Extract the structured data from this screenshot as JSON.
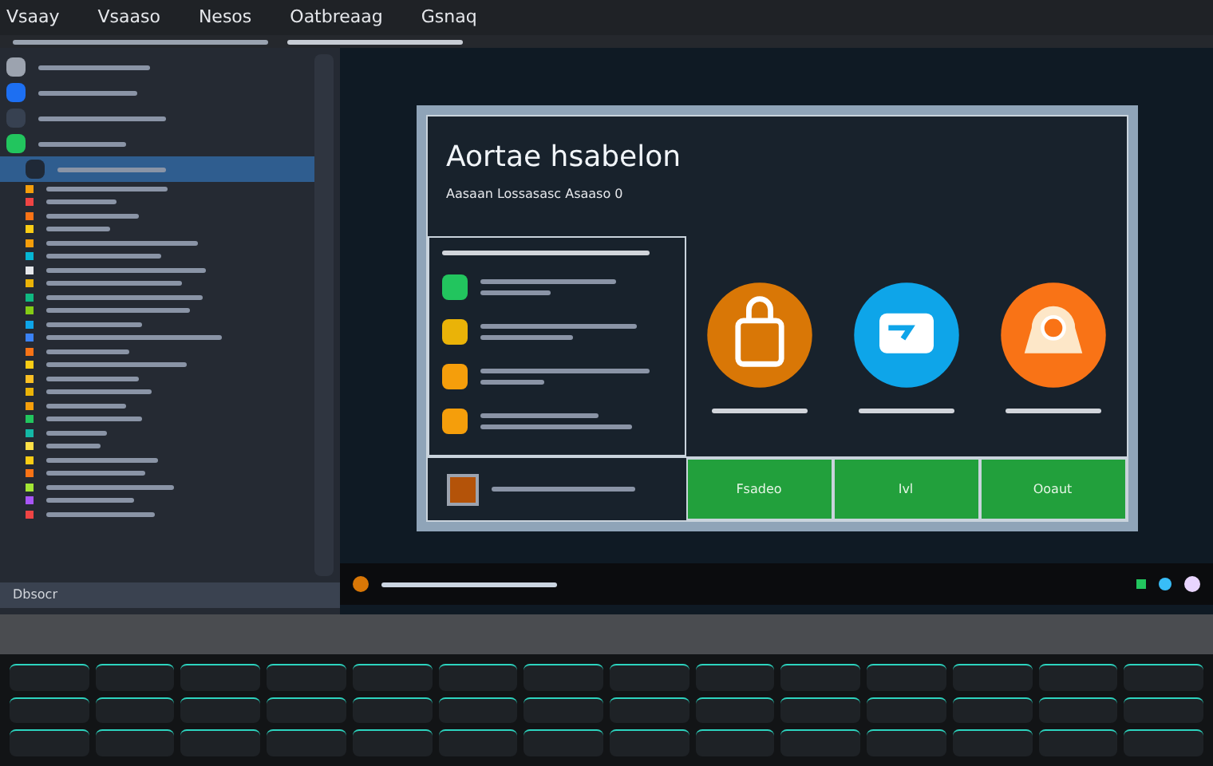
{
  "menu": [
    "Vsaay",
    "Vsaaso",
    "Nesos",
    "Oatbreaag",
    "Gsnaq"
  ],
  "sidebar": {
    "items": [
      {
        "color": "#9ca3af",
        "selected": false
      },
      {
        "color": "#1d6ff2",
        "selected": false
      },
      {
        "color": "#374151",
        "selected": false
      },
      {
        "color": "#22c55e",
        "selected": false
      },
      {
        "color": "#1f2937",
        "selected": true
      },
      {
        "color": "#f59e0b",
        "selected": false
      },
      {
        "color": "#ef4444",
        "selected": false
      },
      {
        "color": "#f97316",
        "selected": false
      },
      {
        "color": "#facc15",
        "selected": false
      },
      {
        "color": "#f59e0b",
        "selected": false
      },
      {
        "color": "#06b6d4",
        "selected": false
      },
      {
        "color": "#e5e7eb",
        "selected": false
      },
      {
        "color": "#eab308",
        "selected": false
      },
      {
        "color": "#10b981",
        "selected": false
      },
      {
        "color": "#84cc16",
        "selected": false
      },
      {
        "color": "#0ea5e9",
        "selected": false
      },
      {
        "color": "#3b82f6",
        "selected": false
      },
      {
        "color": "#f97316",
        "selected": false
      },
      {
        "color": "#facc15",
        "selected": false
      },
      {
        "color": "#fbbf24",
        "selected": false
      },
      {
        "color": "#eab308",
        "selected": false
      },
      {
        "color": "#f59e0b",
        "selected": false
      },
      {
        "color": "#22c55e",
        "selected": false
      },
      {
        "color": "#14b8a6",
        "selected": false
      },
      {
        "color": "#fde047",
        "selected": false
      },
      {
        "color": "#facc15",
        "selected": false
      },
      {
        "color": "#f97316",
        "selected": false
      },
      {
        "color": "#a3e635",
        "selected": false
      },
      {
        "color": "#a855f7",
        "selected": false
      },
      {
        "color": "#ef4444",
        "selected": false
      }
    ],
    "footer": "Dbsocr"
  },
  "dialog": {
    "title": "Aortae hsabelon",
    "subtitle": "Aasaan Lossasasc Asaaso 0",
    "features": [
      {
        "color": "#22c55e"
      },
      {
        "color": "#eab308"
      },
      {
        "color": "#f59e0b"
      },
      {
        "color": "#f59e0b"
      }
    ],
    "apps": [
      {
        "kind": "bag",
        "color": "#d97706"
      },
      {
        "kind": "chat",
        "color": "#0ea5e9"
      },
      {
        "kind": "cap",
        "color": "#f97316"
      }
    ],
    "buttons": [
      "Fsadeo",
      "Ivl",
      "Ooaut"
    ]
  }
}
